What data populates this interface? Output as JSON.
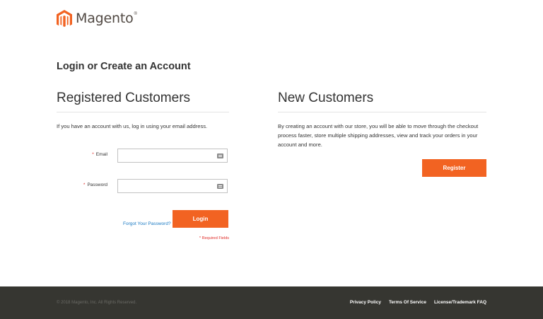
{
  "header": {
    "logo_text": "Magento",
    "logo_mark": "®",
    "logo_icon": "magento-logo-icon",
    "brand_color": "#f26322"
  },
  "page": {
    "title": "Login or Create an Account"
  },
  "registered": {
    "heading": "Registered Customers",
    "intro": "If you have an account with us, log in using your email address.",
    "email": {
      "label": "Email",
      "required_mark": "*",
      "value": "",
      "icon": "autofill-key-icon"
    },
    "password": {
      "label": "Password",
      "required_mark": "*",
      "value": "",
      "icon": "autofill-key-icon"
    },
    "forgot_link": "Forgot Your Password?",
    "login_button": "Login",
    "required_note": "* Required Fields"
  },
  "new_customers": {
    "heading": "New Customers",
    "intro": "By creating an account with our store, you will be able to move through the checkout process faster, store multiple shipping addresses, view and track your orders in your account and more.",
    "register_button": "Register"
  },
  "footer": {
    "copyright": "© 2018 Magento, Inc. All Rights Reserved.",
    "links": [
      "Privacy Policy",
      "Terms Of Service",
      "License/Trademark FAQ"
    ],
    "background": "#363631"
  },
  "colors": {
    "accent": "#f26322",
    "link": "#1979c3",
    "required": "#e02b27"
  }
}
